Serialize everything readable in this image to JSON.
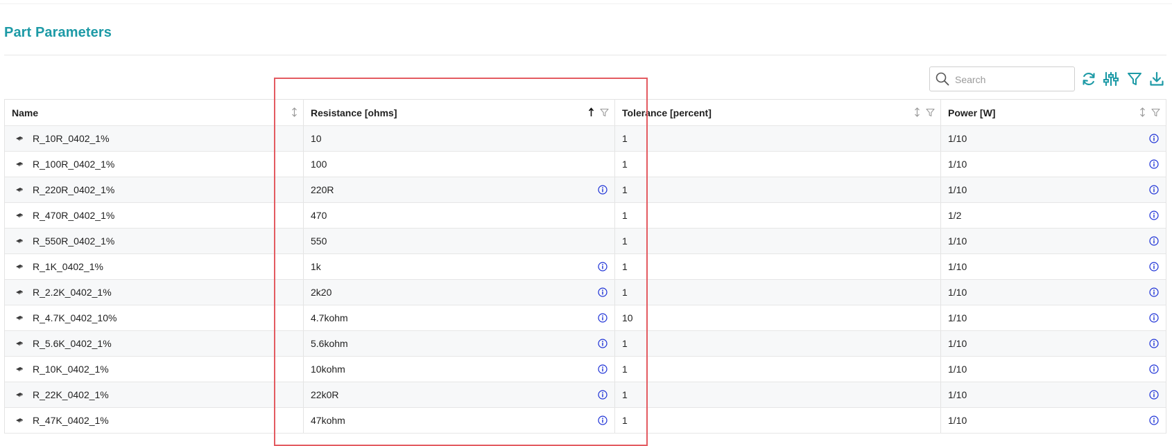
{
  "page": {
    "title": "Part Parameters"
  },
  "toolbar": {
    "search_placeholder": "Search",
    "icons": [
      "search-icon",
      "refresh-icon",
      "column-settings-icon",
      "filter-icon",
      "download-icon"
    ],
    "accent": "#1d9aa6"
  },
  "table": {
    "columns": [
      {
        "label": "Name",
        "sort": "none",
        "filter": false
      },
      {
        "label": "Resistance [ohms]",
        "sort": "ascending",
        "filter": true
      },
      {
        "label": "Tolerance [percent]",
        "sort": "none",
        "filter": true
      },
      {
        "label": "Power [W]",
        "sort": "none",
        "filter": true
      }
    ],
    "rows": [
      {
        "name": "R_10R_0402_1%",
        "resistance": "10",
        "res_info": false,
        "tolerance": "1",
        "power": "1/10"
      },
      {
        "name": "R_100R_0402_1%",
        "resistance": "100",
        "res_info": false,
        "tolerance": "1",
        "power": "1/10"
      },
      {
        "name": "R_220R_0402_1%",
        "resistance": "220R",
        "res_info": true,
        "tolerance": "1",
        "power": "1/10"
      },
      {
        "name": "R_470R_0402_1%",
        "resistance": "470",
        "res_info": false,
        "tolerance": "1",
        "power": "1/2"
      },
      {
        "name": "R_550R_0402_1%",
        "resistance": "550",
        "res_info": false,
        "tolerance": "1",
        "power": "1/10"
      },
      {
        "name": "R_1K_0402_1%",
        "resistance": "1k",
        "res_info": true,
        "tolerance": "1",
        "power": "1/10"
      },
      {
        "name": "R_2.2K_0402_1%",
        "resistance": "2k20",
        "res_info": true,
        "tolerance": "1",
        "power": "1/10"
      },
      {
        "name": "R_4.7K_0402_10%",
        "resistance": "4.7kohm",
        "res_info": true,
        "tolerance": "10",
        "power": "1/10"
      },
      {
        "name": "R_5.6K_0402_1%",
        "resistance": "5.6kohm",
        "res_info": true,
        "tolerance": "1",
        "power": "1/10"
      },
      {
        "name": "R_10K_0402_1%",
        "resistance": "10kohm",
        "res_info": true,
        "tolerance": "1",
        "power": "1/10"
      },
      {
        "name": "R_22K_0402_1%",
        "resistance": "22k0R",
        "res_info": true,
        "tolerance": "1",
        "power": "1/10"
      },
      {
        "name": "R_47K_0402_1%",
        "resistance": "47kohm",
        "res_info": true,
        "tolerance": "1",
        "power": "1/10"
      }
    ]
  },
  "colors": {
    "title": "#1d9aa6",
    "info": "#1a2fd6",
    "highlight": "#e35a60"
  }
}
